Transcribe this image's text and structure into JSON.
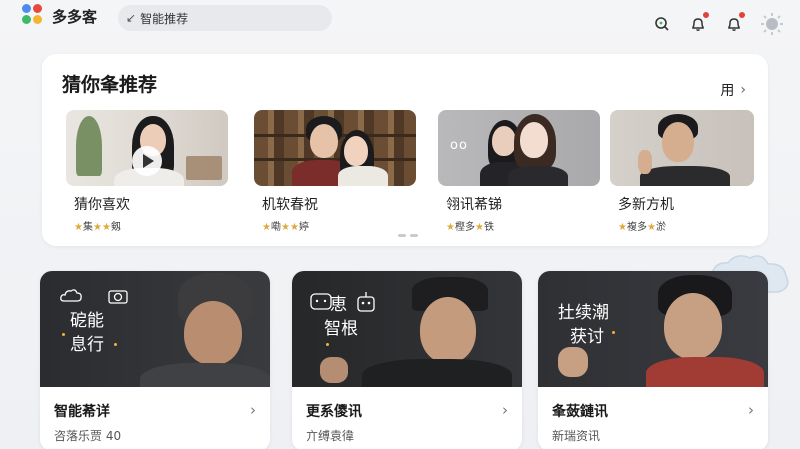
{
  "app": {
    "title": "多多客"
  },
  "search": {
    "icon_glyph": "↙",
    "text": "智能推荐"
  },
  "header_icons": [
    "search-icon",
    "bell-icon",
    "notification-bell-icon",
    "avatar"
  ],
  "panel": {
    "title": "猜你夆推荐",
    "more_label": "用",
    "more_chevron": "›",
    "cards": [
      {
        "title": "猜你喜欢",
        "rating": [
          "★",
          "集",
          "★",
          "★",
          "剱"
        ],
        "has_play": true
      },
      {
        "title": "机软春祝",
        "rating": [
          "★",
          "嘞",
          "★",
          "★",
          "婷"
        ]
      },
      {
        "title": "翎讯莃锑",
        "rating": [
          "★",
          "樫多",
          "★",
          "铁"
        ]
      },
      {
        "title": "多新方机",
        "rating": [
          "★",
          "複多",
          "★",
          "淤"
        ]
      }
    ]
  },
  "features": [
    {
      "overlay_lines": [
        "砨能",
        "息行"
      ],
      "title": "智能莃详",
      "subtitle": "咨落乐贾 40",
      "chevron": "›"
    },
    {
      "overlay_lines": [
        "恵",
        "智根"
      ],
      "title": "更系儍讯",
      "subtitle": "亣缚袁徫",
      "chevron": "›"
    },
    {
      "overlay_lines": [
        "扗续潮",
        "获讨"
      ],
      "title": "夆蔹鏈讯",
      "subtitle": "新瑞资讯",
      "chevron": "›"
    }
  ],
  "colors": {
    "accent_star": "#e0a93b",
    "notification_dot": "#e5413a",
    "overlay_accent": "#f5b230"
  }
}
